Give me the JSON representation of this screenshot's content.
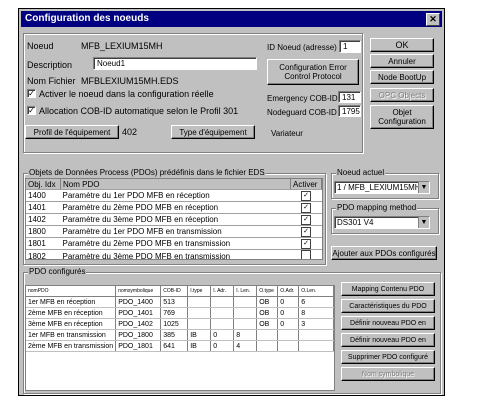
{
  "window": {
    "title": "Configuration des noeuds"
  },
  "node": {
    "noeud_label": "Noeud",
    "noeud_value": "MFB_LEXIUM15MH",
    "description_label": "Description",
    "description_value": "Noeud1",
    "nom_fichier_label": "Nom Fichier",
    "nom_fichier_value": "MFBLEXIUM15MH.EDS",
    "activer_label": "Activer le noeud dans la configuration réelle",
    "allocation_label": "Allocation COB-ID automatique selon le Profil 301",
    "profil_button": "Profil de l'équipement",
    "profil_value": "402",
    "type_button": "Type d'équipement",
    "variateur": "Variateur",
    "id_label": "ID Noeud (adresse)",
    "id_value": "1",
    "config_error_button": "Configuration  Error Control  Protocol",
    "emergency_label": "Emergency COB-ID",
    "emergency_value": "131",
    "nodeguard_label": "Nodeguard COB-ID",
    "nodeguard_value": "1795"
  },
  "buttons": {
    "ok": "OK",
    "annuler": "Annuler",
    "node_bootup": "Node BootUp",
    "opc_objects": "OPC Objects",
    "objet_config": "Objet Configuration"
  },
  "pdo_predef": {
    "group_title": "Objets de Données Process (PDOs) prédéfinis dans le fichier EDS",
    "headers": [
      "Obj. Idx",
      "Nom PDO",
      "Activer"
    ],
    "rows": [
      {
        "idx": "1400",
        "name": "Paramètre du 1er PDO MFB en réception",
        "checked": "✓"
      },
      {
        "idx": "1401",
        "name": "Paramètre du 2ème PDO MFB en réception",
        "checked": "✓"
      },
      {
        "idx": "1402",
        "name": "Paramètre du 3ème PDO MFB en réception",
        "checked": "✓"
      },
      {
        "idx": "1800",
        "name": "Paramètre du 1er PDO MFB en transmission",
        "checked": "✓"
      },
      {
        "idx": "1801",
        "name": "Paramètre du 2ème PDO MFB en transmission",
        "checked": "✓"
      },
      {
        "idx": "1802",
        "name": "Paramètre du 3ème PDO MFB en transmission",
        "checked": ""
      }
    ]
  },
  "noeud_actuel": {
    "label": "Noeud actuel",
    "value": "1 / MFB_LEXIUM15MH"
  },
  "pdo_mapping": {
    "label": "PDO mapping method",
    "value": "DS301 V4"
  },
  "ajouter_button": "Ajouter aux PDOs configurés",
  "pdo_configured": {
    "group_title": "PDO configurés",
    "headers": [
      "nomPDO",
      "nomsymbolique",
      "COB-ID",
      "I.type",
      "I. Adr.",
      "I. Len.",
      "O.type",
      "O.Adr.",
      "O.Len."
    ],
    "rows": [
      [
        "1er MFB en réception",
        "PDO_1400",
        "513",
        "",
        "",
        "",
        "OB",
        "0",
        "6"
      ],
      [
        "2ème MFB en réception",
        "PDO_1401",
        "769",
        "",
        "",
        "",
        "OB",
        "0",
        "8"
      ],
      [
        "3ème MFB en réception",
        "PDO_1402",
        "1025",
        "",
        "",
        "",
        "OB",
        "0",
        "3"
      ],
      [
        "1er MFB en transmission",
        "PDO_1800",
        "385",
        "IB",
        "0",
        "8",
        "",
        "",
        ""
      ],
      [
        "2ème MFB en transmission",
        "PDO_1801",
        "641",
        "IB",
        "0",
        "4",
        "",
        "",
        ""
      ]
    ],
    "buttons": [
      "Mapping Contenu PDO",
      "Caractéristiques du PDO",
      "Définir nouveau PDO en",
      "Définir nouveau PDO en",
      "Supprimer PDO configuré",
      "Nom symbolique"
    ]
  }
}
